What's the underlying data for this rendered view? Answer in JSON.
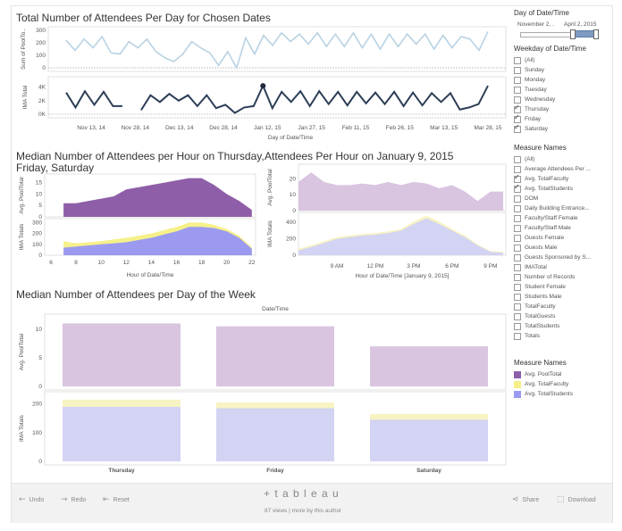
{
  "dashboard": {
    "title1": "Total Number of Attendees Per Day for Chosen Dates",
    "title2a": "Median Number of Attendees per Hour on Thursday,",
    "title2b": "Friday, Saturday",
    "title3": "Attendees Per Hour on January 9, 2015",
    "title4": "Median Number of Attendees per Day of the Week"
  },
  "sidebar": {
    "date_filter_title": "Day of Date/Time",
    "date_start": "November 2, .",
    "date_end": "April 2, 2015",
    "weekday_title": "Weekday of Date/Time",
    "weekdays": [
      {
        "label": "(All)",
        "checked": false
      },
      {
        "label": "Sunday",
        "checked": false
      },
      {
        "label": "Monday",
        "checked": false
      },
      {
        "label": "Tuesday",
        "checked": false
      },
      {
        "label": "Wednesday",
        "checked": false
      },
      {
        "label": "Thursday",
        "checked": true
      },
      {
        "label": "Friday",
        "checked": true
      },
      {
        "label": "Saturday",
        "checked": true
      }
    ],
    "measures_title": "Measure Names",
    "measures": [
      {
        "label": "(All)",
        "checked": false
      },
      {
        "label": "Average Attendees Per ...",
        "checked": false
      },
      {
        "label": "Avg. TotalFaculty",
        "checked": true
      },
      {
        "label": "Avg. TotalStudents",
        "checked": true
      },
      {
        "label": "DOM",
        "checked": false
      },
      {
        "label": "Daily Building Entrance...",
        "checked": false
      },
      {
        "label": "Faculty/Staff Female",
        "checked": false
      },
      {
        "label": "Faculty/Staff Male",
        "checked": false
      },
      {
        "label": "Guests Female",
        "checked": false
      },
      {
        "label": "Guests Male",
        "checked": false
      },
      {
        "label": "Guests Sponsored by S...",
        "checked": false
      },
      {
        "label": "IMATotal",
        "checked": false
      },
      {
        "label": "Number of Records",
        "checked": false
      },
      {
        "label": "Student Female",
        "checked": false
      },
      {
        "label": "Students Male",
        "checked": false
      },
      {
        "label": "TotalFaculty",
        "checked": false
      },
      {
        "label": "TotalGuests",
        "checked": false
      },
      {
        "label": "TotalStudents",
        "checked": false
      },
      {
        "label": "Totals",
        "checked": false
      }
    ],
    "legend_title": "Measure Names",
    "legend": [
      {
        "label": "Avg. PoolTotal",
        "color": "#8e5ea8"
      },
      {
        "label": "Avg. TotalFaculty",
        "color": "#f6f08a"
      },
      {
        "label": "Avg. TotalStudents",
        "color": "#9b9af0"
      }
    ]
  },
  "footer": {
    "undo": "Undo",
    "redo": "Redo",
    "reset": "Reset",
    "logo": "+ t a b l e a u",
    "views": "87 views | more by this author",
    "share": "Share",
    "download": "Download"
  },
  "chart_data": [
    {
      "type": "line",
      "title": "Total Number of Attendees Per Day for Chosen Dates",
      "xlabel": "Day of Date/Time",
      "x_ticks": [
        "Nov 13, 14",
        "Nov 28, 14",
        "Dec 13, 14",
        "Dec 28, 14",
        "Jan 12, 15",
        "Jan 27, 15",
        "Feb 11, 15",
        "Feb 26, 15",
        "Mar 13, 15",
        "Mar 28, 15"
      ],
      "panels": [
        {
          "ylabel": "Sum of PoolTo..",
          "y_ticks": [
            "300",
            "200",
            "100",
            "0"
          ],
          "ylim": [
            0,
            300
          ],
          "color": "#b8d2e3",
          "values": [
            220,
            140,
            230,
            160,
            250,
            120,
            110,
            210,
            160,
            230,
            130,
            80,
            50,
            110,
            210,
            160,
            120,
            20,
            130,
            0,
            240,
            110,
            260,
            180,
            280,
            210,
            270,
            190,
            280,
            170,
            270,
            170,
            280,
            160,
            270,
            150,
            270,
            170,
            270,
            190,
            270,
            150,
            260,
            160,
            250,
            230,
            140,
            290
          ]
        },
        {
          "ylabel": "IMA Total",
          "y_ticks": [
            "4K",
            "2K",
            "0K"
          ],
          "ylim": [
            0,
            5000
          ],
          "color": "#2d3e57",
          "values": [
            3200,
            1000,
            3400,
            1400,
            3300,
            1200,
            1200,
            null,
            600,
            2800,
            1800,
            3000,
            2000,
            2800,
            1200,
            2800,
            900,
            1400,
            200,
            1000,
            1200,
            4200,
            900,
            3300,
            1800,
            3400,
            1200,
            3400,
            1500,
            3300,
            1300,
            3300,
            1600,
            3200,
            1500,
            3300,
            1200,
            3200,
            1300,
            3100,
            1800,
            3100,
            700,
            1000,
            1500,
            4200
          ]
        }
      ]
    },
    {
      "type": "area",
      "title": "Median Number of Attendees per Hour on Thursday, Friday, Saturday",
      "xlabel": "Hour of Date/Time",
      "x": [
        6,
        7,
        8,
        9,
        10,
        11,
        12,
        13,
        14,
        15,
        16,
        17,
        18,
        19,
        20,
        21,
        22
      ],
      "x_ticks": [
        "6",
        "8",
        "10",
        "12",
        "14",
        "16",
        "18",
        "20",
        "22"
      ],
      "panels": [
        {
          "ylabel": "Avg. PoolTotal",
          "y_ticks": [
            "15",
            "10",
            "5",
            "0"
          ],
          "ylim": [
            0,
            18
          ],
          "series": [
            {
              "name": "Avg. PoolTotal",
              "color": "#8e5ea8",
              "values": [
                null,
                6,
                6,
                7,
                8,
                9,
                12,
                13,
                14,
                15,
                16,
                17,
                17,
                14,
                10,
                7,
                3
              ]
            }
          ]
        },
        {
          "ylabel": "IMA Totals",
          "y_ticks": [
            "300",
            "200",
            "100",
            "0"
          ],
          "ylim": [
            0,
            320
          ],
          "series": [
            {
              "name": "Avg. TotalStudents",
              "color": "#9b9af0",
              "values": [
                null,
                70,
                80,
                90,
                100,
                110,
                120,
                140,
                160,
                190,
                220,
                260,
                260,
                250,
                220,
                160,
                60
              ]
            },
            {
              "name": "Avg. TotalFaculty",
              "color": "#f6f08a",
              "values": [
                null,
                130,
                110,
                120,
                130,
                145,
                160,
                180,
                200,
                230,
                260,
                300,
                300,
                280,
                240,
                180,
                70
              ]
            }
          ]
        }
      ]
    },
    {
      "type": "area",
      "title": "Attendees Per Hour on January 9, 2015",
      "xlabel": "Hour of Date/Time [January 9, 2015]",
      "x": [
        6,
        7,
        8,
        9,
        10,
        11,
        12,
        13,
        14,
        15,
        16,
        17,
        18,
        19,
        20,
        21,
        22
      ],
      "x_ticks": [
        "9 AM",
        "12 PM",
        "3 PM",
        "6 PM",
        "9 PM"
      ],
      "panels": [
        {
          "ylabel": "Avg. PoolTotal",
          "y_ticks": [
            "20",
            "10",
            "0"
          ],
          "ylim": [
            0,
            28
          ],
          "series": [
            {
              "name": "Avg. PoolTotal",
              "color": "#d9c5e0",
              "values": [
                18,
                24,
                18,
                16,
                16,
                17,
                16,
                18,
                16,
                18,
                17,
                14,
                16,
                12,
                6,
                12,
                12
              ]
            }
          ]
        },
        {
          "ylabel": "IMA Totals",
          "y_ticks": [
            "400",
            "200",
            "0"
          ],
          "ylim": [
            0,
            500
          ],
          "series": [
            {
              "name": "Avg. TotalStudents",
              "color": "#d3d3f3",
              "values": [
                60,
                100,
                150,
                200,
                220,
                240,
                250,
                270,
                300,
                380,
                450,
                380,
                300,
                220,
                120,
                40,
                30
              ]
            },
            {
              "name": "Avg. TotalFaculty",
              "color": "#f7f3c2",
              "values": [
                80,
                120,
                170,
                220,
                240,
                260,
                270,
                290,
                320,
                410,
                480,
                410,
                320,
                240,
                130,
                50,
                40
              ]
            }
          ]
        }
      ]
    },
    {
      "type": "bar",
      "title": "Median Number of Attendees per Day of the Week",
      "header": "Date/Time",
      "categories": [
        "Thursday",
        "Friday",
        "Saturday"
      ],
      "panels": [
        {
          "ylabel": "Avg. PoolTotal",
          "y_ticks": [
            "10",
            "5",
            "0"
          ],
          "ylim": [
            0,
            12
          ],
          "series": [
            {
              "name": "Avg. PoolTotal",
              "color": "#d9c5e0",
              "values": [
                11,
                10.5,
                7
              ]
            }
          ]
        },
        {
          "ylabel": "IMA Totals",
          "y_ticks": [
            "200",
            "100",
            "0"
          ],
          "ylim": [
            0,
            230
          ],
          "series": [
            {
              "name": "Avg. TotalStudents",
              "color": "#d3d3f3",
              "values": [
                190,
                185,
                145
              ]
            },
            {
              "name": "Avg. TotalFaculty",
              "color": "#f7f3c2",
              "values": [
                215,
                205,
                165
              ]
            }
          ]
        }
      ]
    }
  ]
}
